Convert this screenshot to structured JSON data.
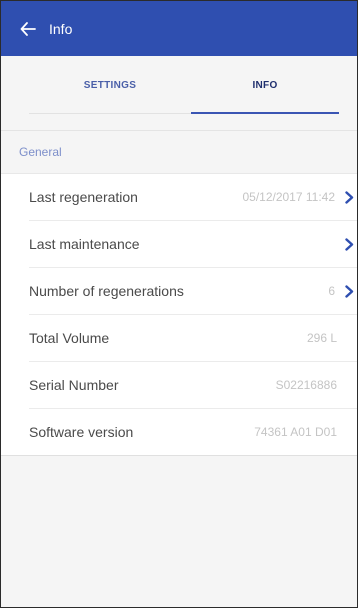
{
  "appbar": {
    "title": "Info",
    "accent": "#2f4fb0"
  },
  "tabs": [
    {
      "label": "SETTINGS",
      "active": false
    },
    {
      "label": "INFO",
      "active": true
    }
  ],
  "section": {
    "title": "General"
  },
  "rows": [
    {
      "label": "Last regeneration",
      "value": "05/12/2017 11:42",
      "chevron": true
    },
    {
      "label": "Last maintenance",
      "value": "",
      "chevron": true
    },
    {
      "label": "Number of regenerations",
      "value": "6",
      "chevron": true
    },
    {
      "label": "Total Volume",
      "value": "296 L",
      "chevron": false
    },
    {
      "label": "Serial Number",
      "value": "S02216886",
      "chevron": false
    },
    {
      "label": "Software version",
      "value": "74361 A01 D01",
      "chevron": false
    }
  ],
  "icons": {
    "back": "arrow-left-icon",
    "chevron": "chevron-right-icon"
  },
  "colors": {
    "chevron": "#2f4fb0",
    "tab_active": "#1f2f6e",
    "tab_inactive": "#4a5fa8",
    "section_title": "#7d8fca"
  }
}
